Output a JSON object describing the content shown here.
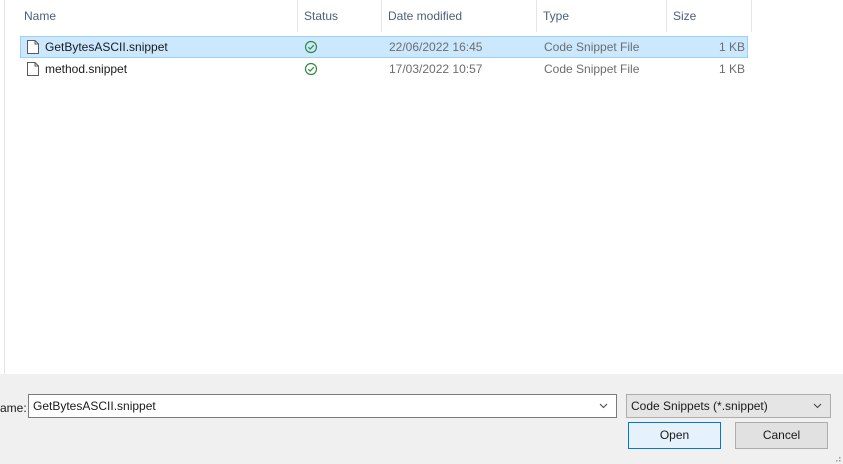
{
  "columns": {
    "name": "Name",
    "status": "Status",
    "date_modified": "Date modified",
    "type": "Type",
    "size": "Size"
  },
  "sort": {
    "column": "Name",
    "indicator_icon": "sort-ascending-caret-icon"
  },
  "files": [
    {
      "name": "GetBytesASCII.snippet",
      "status_icon": "synced-check-icon",
      "date_modified": "22/06/2022 16:45",
      "type": "Code Snippet File",
      "size": "1 KB",
      "selected": true
    },
    {
      "name": "method.snippet",
      "status_icon": "synced-check-icon",
      "date_modified": "17/03/2022 10:57",
      "type": "Code Snippet File",
      "size": "1 KB",
      "selected": false
    }
  ],
  "footer": {
    "file_name_label": "ame:",
    "file_name_value": "GetBytesASCII.snippet",
    "file_type_filter": "Code Snippets (*.snippet)",
    "open_label": "Open",
    "cancel_label": "Cancel"
  },
  "colors": {
    "selection_bg": "#cce8ff",
    "selection_border": "#99d1ff",
    "status_green": "#2e8b3e",
    "header_text": "#4c607a",
    "primary_button_border": "#0078d7"
  }
}
